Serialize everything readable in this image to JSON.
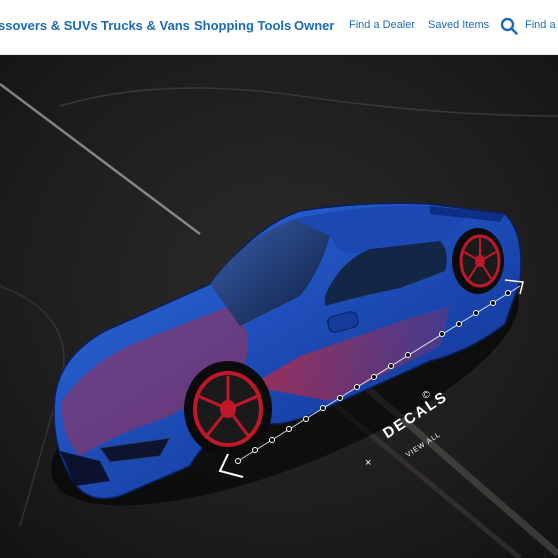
{
  "nav": {
    "items": [
      {
        "label": "ssovers & SUVs"
      },
      {
        "label": "Trucks & Vans"
      },
      {
        "label": "Shopping Tools"
      },
      {
        "label": "Owner"
      }
    ],
    "utility": [
      {
        "label": "Find a Dealer"
      },
      {
        "label": "Saved Items"
      }
    ],
    "search_label": "Find a D",
    "search_icon": "search-icon",
    "link_color": "#1a6bb8"
  },
  "hero": {
    "car_color": "#1f4fb5",
    "decal_color": "#c2263a",
    "wheel_accent": "#c0182b"
  },
  "decals": {
    "title": "DECALS",
    "subtitle": "VIEW ALL",
    "close_glyph": "×",
    "badge_glyph": "©",
    "close_icon": "close-icon",
    "badge_icon": "copyright-badge-icon"
  }
}
